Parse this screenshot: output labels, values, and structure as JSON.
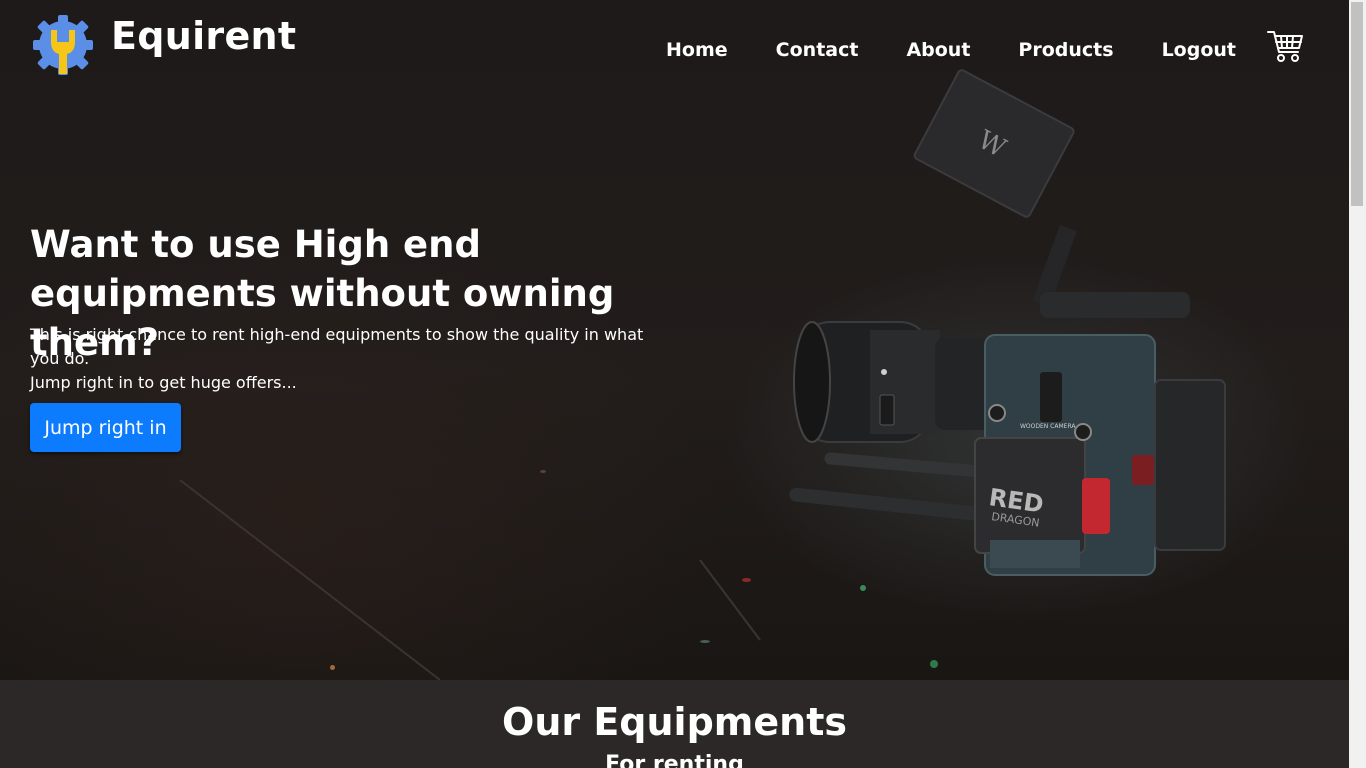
{
  "header": {
    "brand": "Equirent",
    "nav": [
      "Home",
      "Contact",
      "About",
      "Products",
      "Logout"
    ],
    "logo_icon": "gear-wrench-icon",
    "cart_icon": "shopping-cart-icon"
  },
  "hero": {
    "headline": "Want to use High end equipments without owning them?",
    "subtext_line1": "This is right chance to rent high-end equipments to show the quality in what you do.",
    "subtext_line2": "Jump right in to get huge offers...",
    "cta_label": "Jump right in",
    "camera_labels": {
      "brand": "RED",
      "model": "DRAGON",
      "top_handle": "WOODEN CAMERA"
    }
  },
  "equipments": {
    "title": "Our Equipments",
    "subtitle": "For renting"
  },
  "colors": {
    "accent": "#0d7bfd",
    "section_bg": "#2b2827",
    "logo_gear": "#5b8ee6",
    "logo_wrench": "#f5c518"
  }
}
